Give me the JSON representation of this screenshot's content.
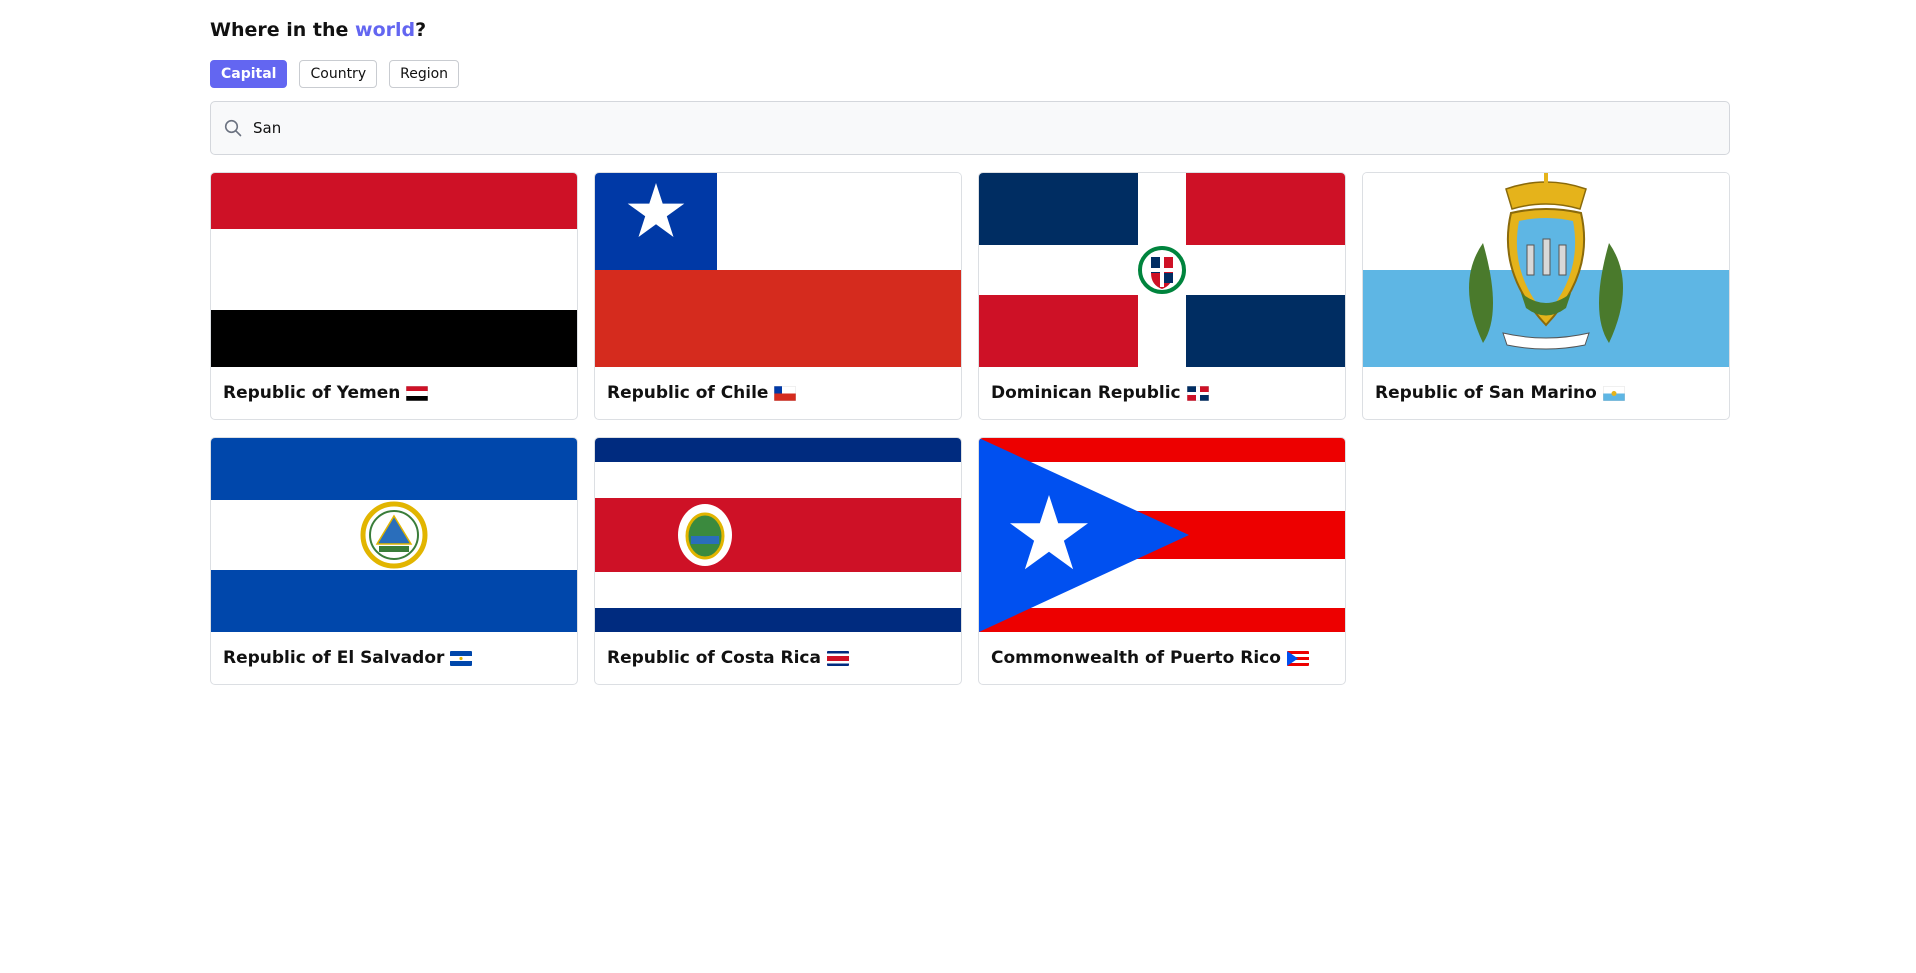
{
  "header": {
    "title_prefix": "Where in the ",
    "title_accent": "world",
    "title_suffix": "?"
  },
  "filters": [
    {
      "label": "Capital",
      "active": true
    },
    {
      "label": "Country",
      "active": false
    },
    {
      "label": "Region",
      "active": false
    }
  ],
  "search": {
    "value": "San",
    "icon": "search-icon"
  },
  "countries": [
    {
      "name": "Republic of Yemen",
      "flag": "yemen"
    },
    {
      "name": "Republic of Chile",
      "flag": "chile"
    },
    {
      "name": "Dominican Republic",
      "flag": "dominican-republic"
    },
    {
      "name": "Republic of San Marino",
      "flag": "san-marino"
    },
    {
      "name": "Republic of El Salvador",
      "flag": "el-salvador"
    },
    {
      "name": "Republic of Costa Rica",
      "flag": "costa-rica"
    },
    {
      "name": "Commonwealth of Puerto Rico",
      "flag": "puerto-rico"
    }
  ],
  "colors": {
    "accent": "#6366f1"
  }
}
